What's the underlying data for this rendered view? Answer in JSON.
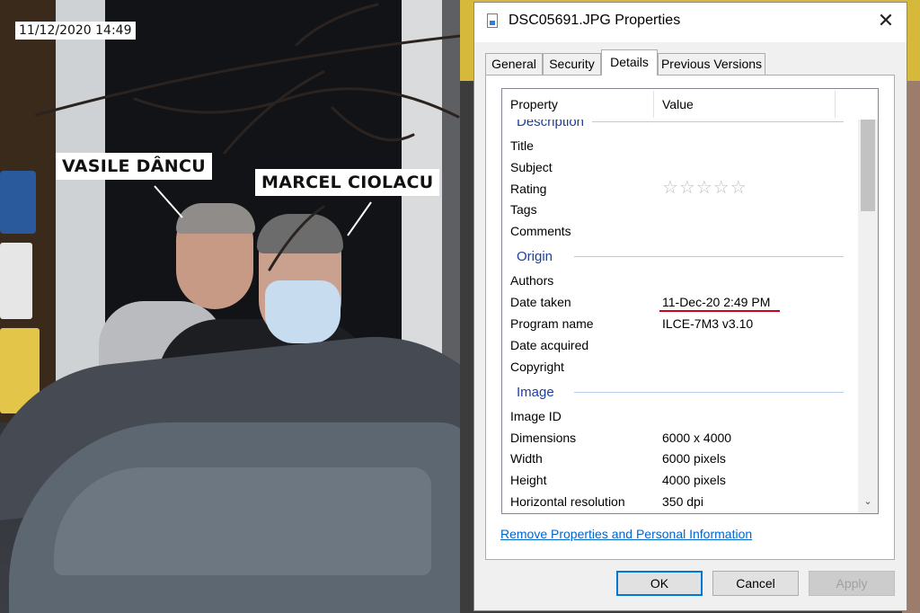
{
  "photo": {
    "timestamp": "11/12/2020 14:49",
    "labels": [
      "VASILE DÂNCU",
      "MARCEL CIOLACU"
    ]
  },
  "dialog": {
    "title": "DSC05691.JPG Properties",
    "close_glyph": "✕",
    "tabs": [
      "General",
      "Security",
      "Details",
      "Previous Versions"
    ],
    "active_tab": "Details",
    "columns": {
      "property": "Property",
      "value": "Value"
    },
    "groups": {
      "description": "Description",
      "origin": "Origin",
      "image": "Image"
    },
    "description_rows": [
      {
        "property": "Title",
        "value": ""
      },
      {
        "property": "Subject",
        "value": ""
      },
      {
        "property": "Rating",
        "value": "",
        "stars": "☆☆☆☆☆"
      },
      {
        "property": "Tags",
        "value": ""
      },
      {
        "property": "Comments",
        "value": ""
      }
    ],
    "origin_rows": [
      {
        "property": "Authors",
        "value": ""
      },
      {
        "property": "Date taken",
        "value": "11-Dec-20 2:49 PM"
      },
      {
        "property": "Program name",
        "value": "ILCE-7M3 v3.10"
      },
      {
        "property": "Date acquired",
        "value": ""
      },
      {
        "property": "Copyright",
        "value": ""
      }
    ],
    "image_rows": [
      {
        "property": "Image ID",
        "value": ""
      },
      {
        "property": "Dimensions",
        "value": "6000 x 4000"
      },
      {
        "property": "Width",
        "value": "6000 pixels"
      },
      {
        "property": "Height",
        "value": "4000 pixels"
      },
      {
        "property": "Horizontal resolution",
        "value": "350 dpi"
      }
    ],
    "remove_link": "Remove Properties and Personal Information",
    "buttons": {
      "ok": "OK",
      "cancel": "Cancel",
      "apply": "Apply"
    },
    "scroll_up_glyph": "⌃",
    "scroll_down_glyph": "⌄",
    "accent_color": "#0078d7",
    "highlight_color": "#d0021b"
  }
}
